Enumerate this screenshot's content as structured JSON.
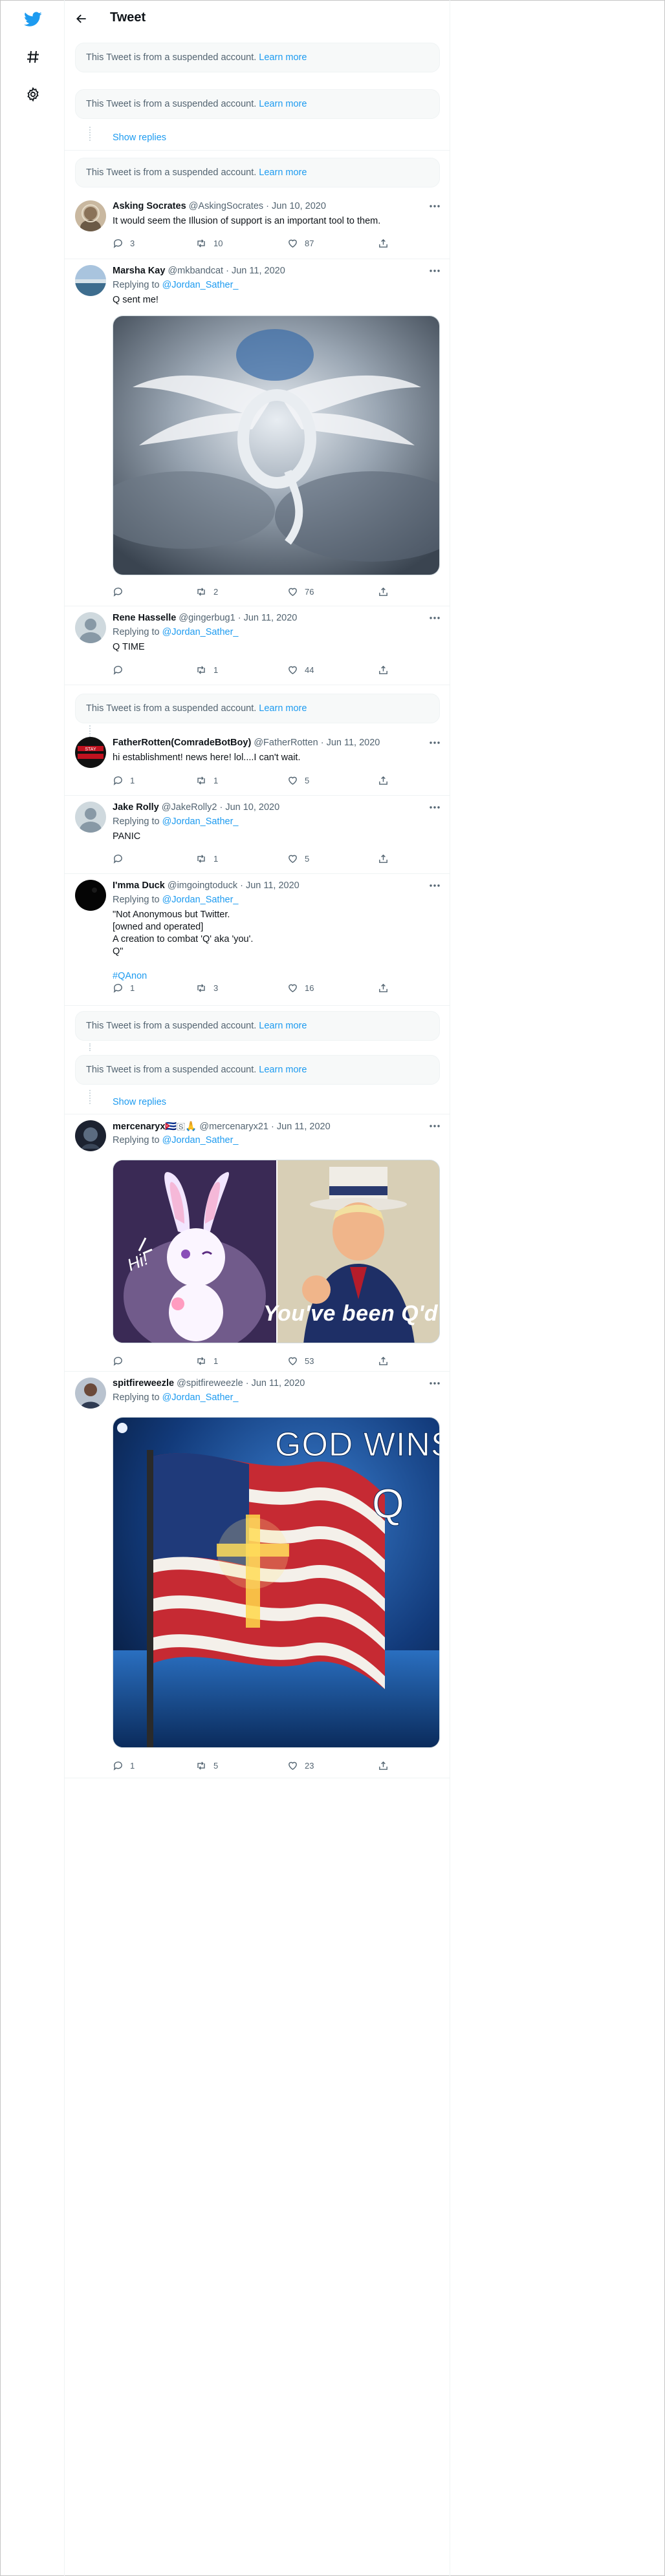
{
  "header": {
    "title": "Tweet"
  },
  "suspended": {
    "text": "This Tweet is from a suspended account.",
    "learn_more": "Learn more"
  },
  "show_replies": "Show replies",
  "tweets": [
    {
      "name": "Asking Socrates",
      "handle": "@AskingSocrates",
      "date": "Jun 10, 2020",
      "text": "It would seem the Illusion of support is an important tool to them.",
      "replies": "3",
      "retweets": "10",
      "likes": "87"
    },
    {
      "name": "Marsha Kay",
      "handle": "@mkbandcat",
      "date": "Jun 11, 2020",
      "replying_to": "Replying to",
      "mention": "@Jordan_Sather_",
      "text": "Q sent me!",
      "replies": "",
      "retweets": "2",
      "likes": "76",
      "media_icon": "q-wings-in-clouds-image"
    },
    {
      "name": "Rene Hasselle",
      "handle": "@gingerbug1",
      "date": "Jun 11, 2020",
      "replying_to": "Replying to",
      "mention": "@Jordan_Sather_",
      "text": "Q TIME",
      "replies": "",
      "retweets": "1",
      "likes": "44"
    },
    {
      "name": "FatherRotten(ComradeBotBoy)",
      "handle": "@FatherRotten",
      "date": "Jun 11, 2020",
      "text": "hi establishment! news here! lol....I can't wait.",
      "replies": "1",
      "retweets": "1",
      "likes": "5"
    },
    {
      "name": "Jake Rolly",
      "handle": "@JakeRolly2",
      "date": "Jun 10, 2020",
      "replying_to": "Replying to",
      "mention": "@Jordan_Sather_",
      "text": "PANIC",
      "replies": "",
      "retweets": "1",
      "likes": "5"
    },
    {
      "name": "I'mma Duck",
      "handle": "@imgoingtoduck",
      "date": "Jun 11, 2020",
      "replying_to": "Replying to",
      "mention": "@Jordan_Sather_",
      "text": "\"Not Anonymous but Twitter.\n[owned and operated]\nA creation to combat 'Q' aka 'you'.\nQ\"",
      "hashtag": "#QAnon",
      "replies": "1",
      "retweets": "3",
      "likes": "16"
    },
    {
      "name": "mercenaryx",
      "name_emojis": "🇨🇺🇸🙏",
      "handle": "@mercenaryx21",
      "date": "Jun 11, 2020",
      "replying_to": "Replying to",
      "mention": "@Jordan_Sather_",
      "text": "",
      "replies": "",
      "retweets": "1",
      "likes": "53",
      "media_left_text": "Hi!",
      "media_right_text": "You've been Q'd"
    },
    {
      "name": "spitfireweezle",
      "handle": "@spitfireweezle",
      "date": "Jun 11, 2020",
      "replying_to": "Replying to",
      "mention": "@Jordan_Sather_",
      "text": "",
      "replies": "1",
      "retweets": "5",
      "likes": "23",
      "media_title": "GOD WINS",
      "media_letter": "Q"
    }
  ],
  "colors": {
    "accent": "#1d9bf0",
    "muted": "#536471",
    "text": "#0f1419",
    "box_bg": "#f7f9f9"
  },
  "icons": [
    "twitter-logo-icon",
    "hashtag-icon",
    "gear-icon",
    "back-arrow-icon",
    "more-icon",
    "reply-icon",
    "retweet-icon",
    "like-icon",
    "share-icon"
  ]
}
